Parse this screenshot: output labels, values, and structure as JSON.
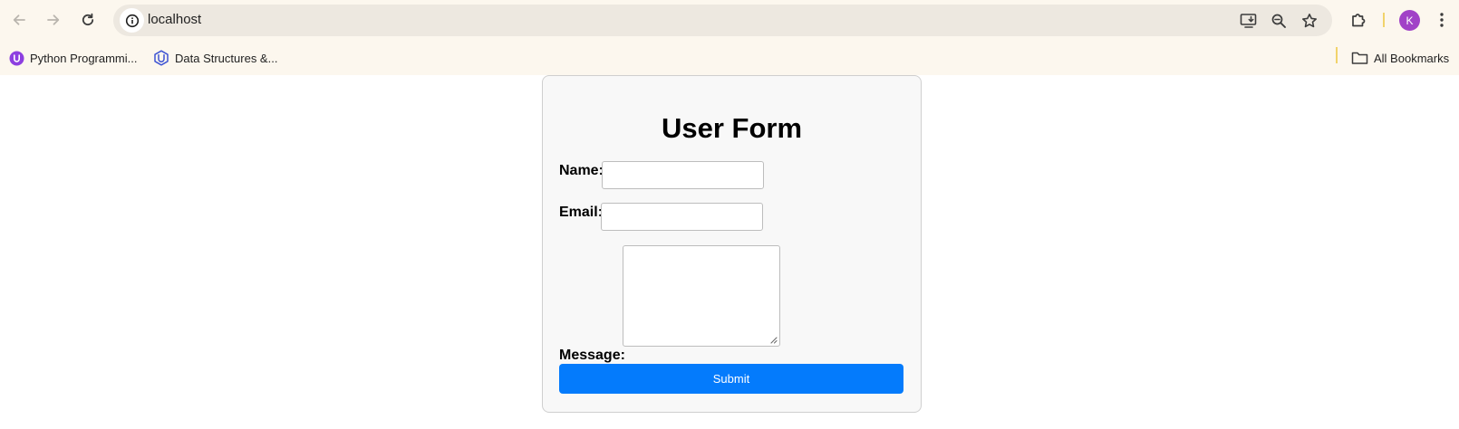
{
  "browser": {
    "url": "localhost",
    "profile_initial": "K",
    "bookmarks": [
      {
        "label": "Python Programmi..."
      },
      {
        "label": "Data Structures &..."
      }
    ],
    "all_bookmarks_label": "All Bookmarks",
    "colors": {
      "toolbar_bg": "#fcf7ee",
      "omnibox_bg": "#ede8e0",
      "avatar_bg": "#a142c7"
    }
  },
  "form": {
    "title": "User Form",
    "name_label": "Name:",
    "name_value": "",
    "email_label": "Email:",
    "email_value": "",
    "message_label": "Message:",
    "message_value": "",
    "submit_label": "Submit",
    "colors": {
      "card_bg": "#f8f8f8",
      "submit_bg": "#047bfc"
    }
  }
}
